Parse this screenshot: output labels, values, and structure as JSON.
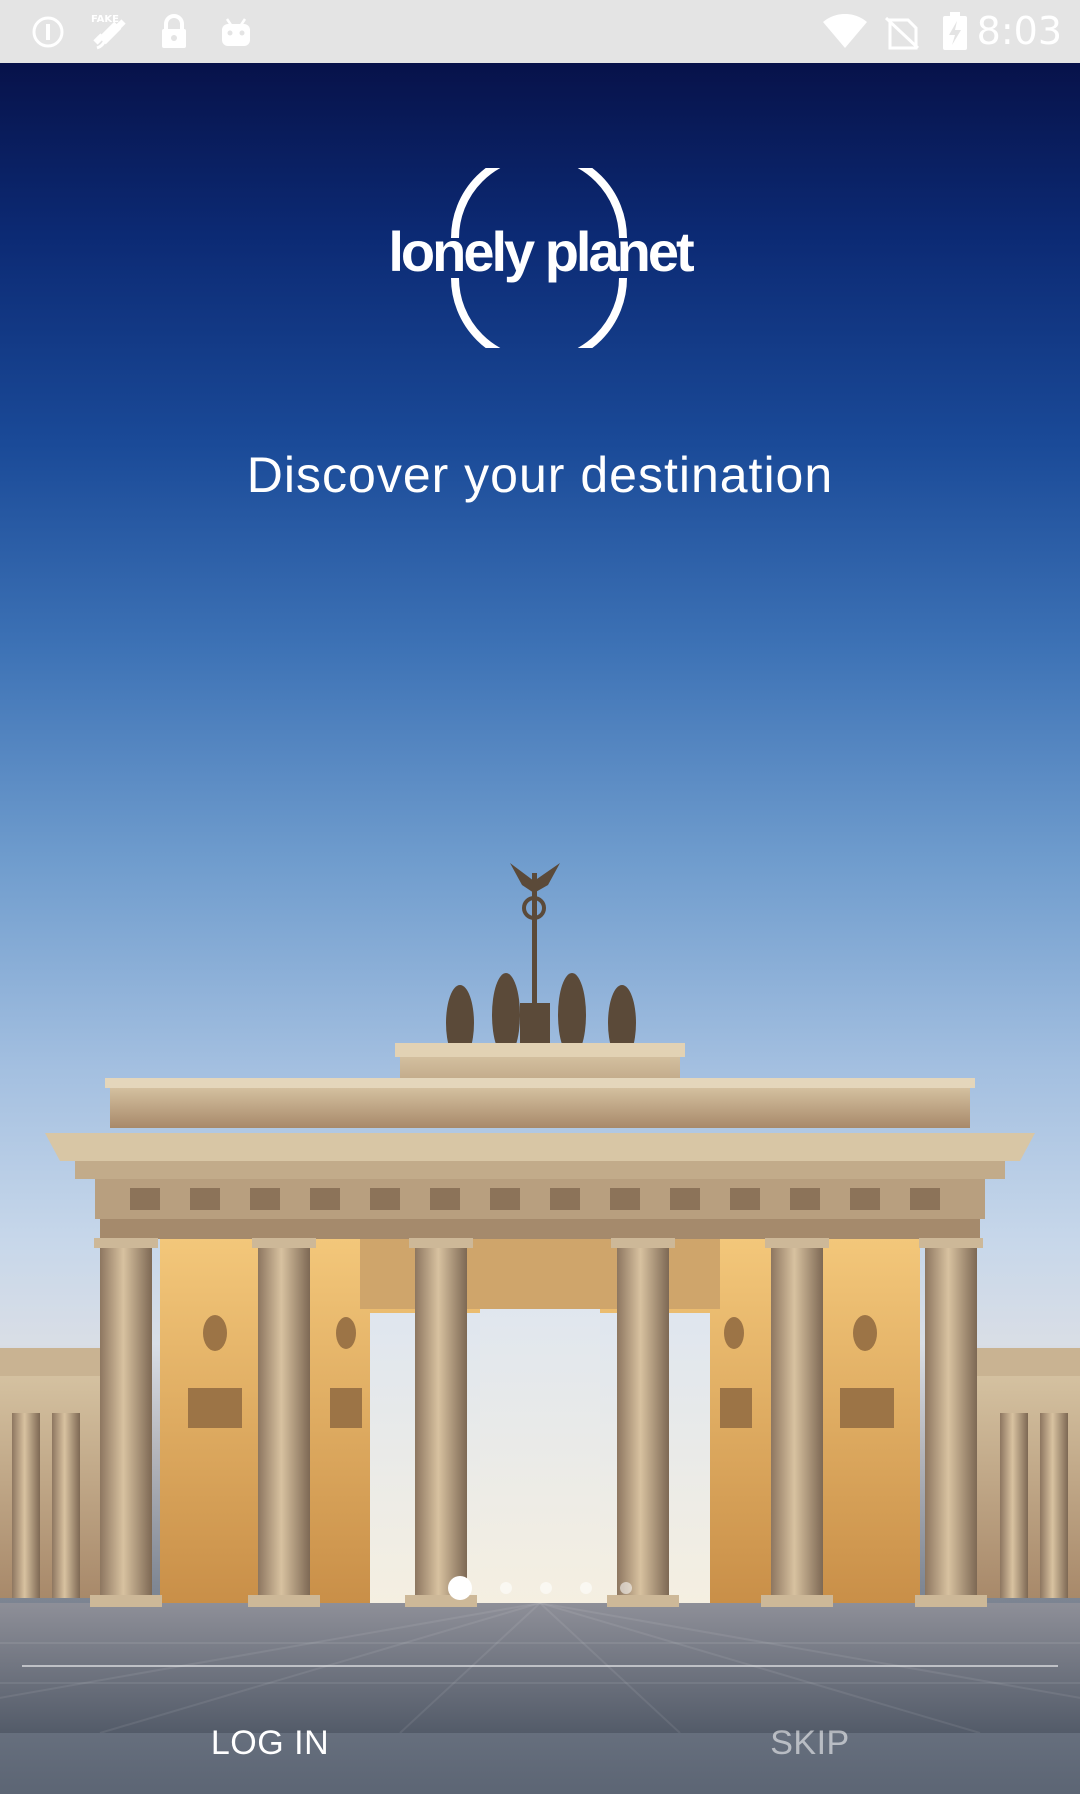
{
  "status_bar": {
    "time": "8:03",
    "icons": [
      "info-icon",
      "fake-gps-icon",
      "lock-icon",
      "android-icon",
      "wifi-icon",
      "no-signal-icon",
      "battery-charging-icon"
    ]
  },
  "brand": {
    "logo_text": "lonely planet"
  },
  "onboarding": {
    "tagline": "Discover your destination",
    "pages_total": 5,
    "active_page": 1
  },
  "actions": {
    "login_label": "LOG IN",
    "skip_label": "SKIP"
  },
  "colors": {
    "sky_top": "#07124a",
    "sky_mid": "#3e73b6",
    "sky_horizon": "#d9dee6",
    "text_primary": "#ffffff",
    "text_muted": "rgba(255,255,255,0.55)",
    "status_bar_bg": "#e4e4e4"
  }
}
